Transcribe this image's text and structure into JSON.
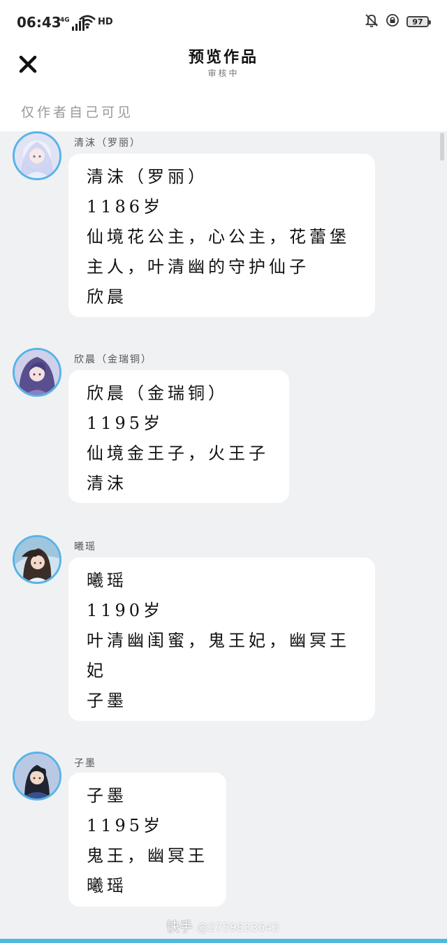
{
  "status_bar": {
    "time": "06:43",
    "network": "4G",
    "hd": "HD",
    "battery": "97"
  },
  "header": {
    "title": "预览作品",
    "subtitle": "审核中",
    "visibility_note": "仅作者自己可见"
  },
  "messages": [
    {
      "name": "清沫（罗丽）",
      "lines": [
        "清沫（罗丽）",
        "1186岁",
        "仙境花公主，心公主，花蕾堡",
        "主人，叶清幽的守护仙子",
        "欣晨"
      ]
    },
    {
      "name": "欣晨（金瑞铜）",
      "lines": [
        "欣晨（金瑞铜）",
        "1195岁",
        "仙境金王子，火王子",
        "清沫"
      ]
    },
    {
      "name": "曦瑶",
      "lines": [
        "曦瑶",
        "1190岁",
        "叶清幽闺蜜，鬼王妃，幽冥王",
        "妃",
        "子墨"
      ]
    },
    {
      "name": "子墨",
      "lines": [
        "子墨",
        "1195岁",
        "鬼王，幽冥王",
        "曦瑶"
      ]
    }
  ],
  "watermark": {
    "brand": "快手",
    "user_id": "@2759833643"
  },
  "colors": {
    "avatar_ring": "#57b3e8",
    "chat_background": "#f0f1f3",
    "bubble": "#ffffff"
  }
}
